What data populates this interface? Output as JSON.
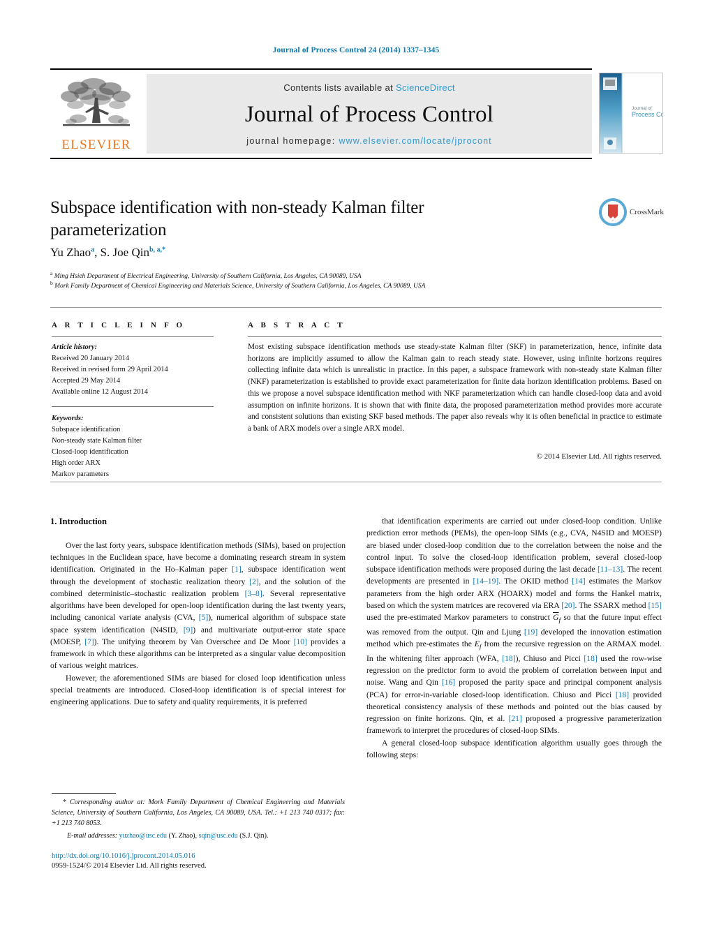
{
  "running_head": "Journal of Process Control 24 (2014) 1337–1345",
  "masthead": {
    "publisher_name": "ELSEVIER",
    "contents_prefix": "Contents lists available at ",
    "contents_link": "ScienceDirect",
    "journal_name": "Journal of Process Control",
    "homepage_prefix": "journal homepage: ",
    "homepage_url": "www.elsevier.com/locate/jprocont",
    "cover_title_line1": "Journal of",
    "cover_title_line2": "Process Control"
  },
  "article": {
    "title": "Subspace identification with non-steady Kalman filter parameterization",
    "authors_html": "Yu Zhao<sup>a</sup>, S. Joe Qin<sup>b, a,</sup><sup>*</sup>",
    "affiliation_a": "Ming Hsieh Department of Electrical Engineering, University of Southern California, Los Angeles, CA 90089, USA",
    "affiliation_b": "Mork Family Department of Chemical Engineering and Materials Science, University of Southern California, Los Angeles, CA 90089, USA",
    "crossmark_label": "CrossMark"
  },
  "info": {
    "heading": "A R T I C L E   I N F O",
    "history_label": "Article history:",
    "history": [
      "Received 20 January 2014",
      "Received in revised form 29 April 2014",
      "Accepted 29 May 2014",
      "Available online 12 August 2014"
    ],
    "keywords_label": "Keywords:",
    "keywords": [
      "Subspace identification",
      "Non-steady state Kalman filter",
      "Closed-loop identification",
      "High order ARX",
      "Markov parameters"
    ]
  },
  "abstract": {
    "heading": "A B S T R A C T",
    "text": "Most existing subspace identification methods use steady-state Kalman filter (SKF) in parameterization, hence, infinite data horizons are implicitly assumed to allow the Kalman gain to reach steady state. However, using infinite horizons requires collecting infinite data which is unrealistic in practice. In this paper, a subspace framework with non-steady state Kalman filter (NKF) parameterization is established to provide exact parameterization for finite data horizon identification problems. Based on this we propose a novel subspace identification method with NKF parameterization which can handle closed-loop data and avoid assumption on infinite horizons. It is shown that with finite data, the proposed parameterization method provides more accurate and consistent solutions than existing SKF based methods. The paper also reveals why it is often beneficial in practice to estimate a bank of ARX models over a single ARX model.",
    "copyright": "© 2014 Elsevier Ltd. All rights reserved."
  },
  "body": {
    "section_number_title": "1.  Introduction",
    "left_paragraphs": [
      "Over the last forty years, subspace identification methods (SIMs), based on projection techniques in the Euclidean space, have become a dominating research stream in system identification. Originated in the Ho–Kalman paper [1], subspace identification went through the development of stochastic realization theory [2], and the solution of the combined deterministic–stochastic realization problem [3–8]. Several representative algorithms have been developed for open-loop identification during the last twenty years, including canonical variate analysis (CVA, [5]), numerical algorithm of subspace state space system identification (N4SID, [9]) and multivariate output-error state space (MOESP, [7]). The unifying theorem by Van Overschee and De Moor [10] provides a framework in which these algorithms can be interpreted as a singular value decomposition of various weight matrices.",
      "However, the aforementioned SIMs are biased for closed loop identification unless special treatments are introduced. Closed-loop identification is of special interest for engineering applications. Due to safety and quality requirements, it is preferred"
    ],
    "right_paragraphs": [
      "that identification experiments are carried out under closed-loop condition. Unlike prediction error methods (PEMs), the open-loop SIMs (e.g., CVA, N4SID and MOESP) are biased under closed-loop condition due to the correlation between the noise and the control input. To solve the closed-loop identification problem, several closed-loop subspace identification methods were proposed during the last decade [11–13]. The recent developments are presented in [14–19]. The OKID method [14] estimates the Markov parameters from the high order ARX (HOARX) model and forms the Hankel matrix, based on which the system matrices are recovered via ERA [20]. The SSARX method [15] used the pre-estimated Markov parameters to construct G̅f so that the future input effect was removed from the output. Qin and Ljung [19] developed the innovation estimation method which pre-estimates the Ef from the recursive regression on the ARMAX model. In the whitening filter approach (WFA, [18]), Chiuso and Picci [18] used the row-wise regression on the predictor form to avoid the problem of correlation between input and noise. Wang and Qin [16] proposed the parity space and principal component analysis (PCA) for error-in-variable closed-loop identification. Chiuso and Picci [18] provided theoretical consistency analysis of these methods and pointed out the bias caused by regression on finite horizons. Qin, et al. [21] proposed a progressive parameterization framework to interpret the procedures of closed-loop SIMs.",
      "A general closed-loop subspace identification algorithm usually goes through the following steps:"
    ]
  },
  "footer": {
    "corresponding_marker": "*",
    "corresponding_text": "Corresponding author at: Mork Family Department of Chemical Engineering and Materials Science, University of Southern California, Los Angeles, CA 90089, USA. Tel.: +1 213 740 0317; fax: +1 213 740 8053.",
    "email_label": "E-mail addresses:",
    "email_1": "yuzhao@usc.edu",
    "email_1_owner": "(Y. Zhao),",
    "email_2": "sqin@usc.edu",
    "email_2_owner": "(S.J. Qin).",
    "doi": "http://dx.doi.org/10.1016/j.jprocont.2014.05.016",
    "issn_line": "0959-1524/© 2014 Elsevier Ltd. All rights reserved."
  },
  "colors": {
    "link_blue": "#0b7bb5",
    "sciencedirect_blue": "#2c9ad1",
    "elsevier_orange": "#E87722",
    "panel_grey": "#e9e9e9"
  }
}
